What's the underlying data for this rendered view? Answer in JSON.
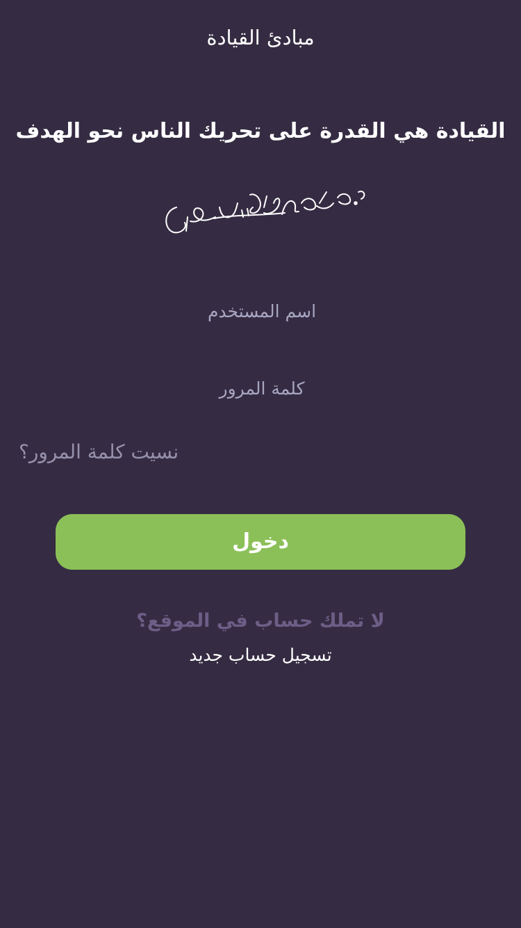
{
  "header": {
    "title": "مبادئ القيادة"
  },
  "main": {
    "headline": "القيادة هي القدرة على تحريك الناس نحو الهدف",
    "signature_text": "د.طارق محمد السويدان"
  },
  "form": {
    "username_placeholder": "اسم المستخدم",
    "password_placeholder": "كلمة المرور",
    "forgot_password_label": "نسيت كلمة المرور؟",
    "login_label": "دخول"
  },
  "footer": {
    "no_account_text": "لا تملك حساب في الموقع؟",
    "register_label": "تسجيل حساب جديد"
  },
  "colors": {
    "background": "#352c43",
    "accent_button": "#8bc058",
    "muted_text": "#9791ad",
    "secondary_text": "#6c5e86"
  }
}
